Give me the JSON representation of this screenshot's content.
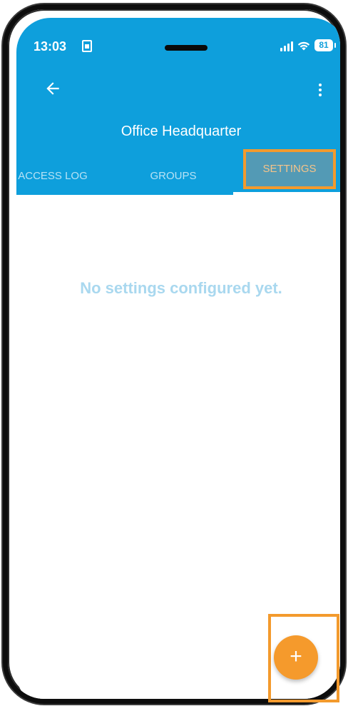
{
  "status_bar": {
    "time": "13:03",
    "battery": "81"
  },
  "header": {
    "title": "Office Headquarter"
  },
  "tabs": [
    {
      "label": "ACCESS LOG"
    },
    {
      "label": "GROUPS"
    },
    {
      "label": "SETTINGS",
      "selected": true
    }
  ],
  "content": {
    "empty_message": "No settings configured yet."
  },
  "fab": {
    "label": "+"
  },
  "colors": {
    "primary": "#0e9fdc",
    "accent": "#f59a2c",
    "highlight": "#f39a2d",
    "empty_text": "#a9d8ef"
  },
  "icons": {
    "back": "arrow-left-icon",
    "menu": "more-vert-icon",
    "sim": "sim-icon",
    "signal": "signal-icon",
    "wifi": "wifi-icon",
    "battery": "battery-icon"
  }
}
